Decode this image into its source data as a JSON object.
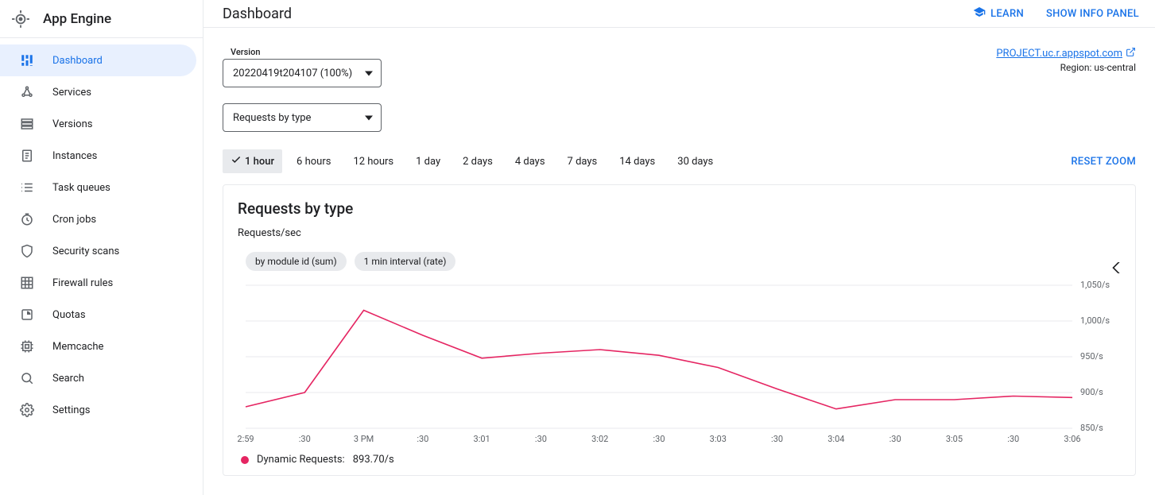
{
  "app": {
    "name": "App Engine"
  },
  "sidebar": {
    "items": [
      {
        "label": "Dashboard",
        "icon": "dashboard",
        "active": true
      },
      {
        "label": "Services",
        "icon": "graph",
        "active": false
      },
      {
        "label": "Versions",
        "icon": "versions",
        "active": false
      },
      {
        "label": "Instances",
        "icon": "clipboard",
        "active": false
      },
      {
        "label": "Task queues",
        "icon": "list",
        "active": false
      },
      {
        "label": "Cron jobs",
        "icon": "clock",
        "active": false
      },
      {
        "label": "Security scans",
        "icon": "shield",
        "active": false
      },
      {
        "label": "Firewall rules",
        "icon": "grid",
        "active": false
      },
      {
        "label": "Quotas",
        "icon": "pie",
        "active": false
      },
      {
        "label": "Memcache",
        "icon": "memory",
        "active": false
      },
      {
        "label": "Search",
        "icon": "search",
        "active": false
      },
      {
        "label": "Settings",
        "icon": "gear",
        "active": false
      }
    ]
  },
  "header": {
    "title": "Dashboard",
    "learn": "LEARN",
    "show_info": "SHOW INFO PANEL"
  },
  "project": {
    "url": "PROJECT.uc.r.appspot.com",
    "region_label": "Region: us-central"
  },
  "version": {
    "label": "Version",
    "value": "20220419t204107 (100%)"
  },
  "metric": {
    "value": "Requests by type"
  },
  "ranges": {
    "items": [
      "1 hour",
      "6 hours",
      "12 hours",
      "1 day",
      "2 days",
      "4 days",
      "7 days",
      "14 days",
      "30 days"
    ],
    "active": "1 hour",
    "reset": "RESET ZOOM"
  },
  "chart": {
    "title": "Requests by type",
    "subtitle": "Requests/sec",
    "chips": [
      "by module id (sum)",
      "1 min interval (rate)"
    ],
    "legend_label": "Dynamic Requests:",
    "legend_value": "893.70/s"
  },
  "chart_data": {
    "type": "line",
    "ylabel": "Requests/sec",
    "ylim": [
      850,
      1050
    ],
    "y_ticks": [
      "1,050/s",
      "1,000/s",
      "950/s",
      "900/s",
      "850/s"
    ],
    "x_ticks": [
      "2:59",
      ":30",
      "3 PM",
      ":30",
      "3:01",
      ":30",
      "3:02",
      ":30",
      "3:03",
      ":30",
      "3:04",
      ":30",
      "3:05",
      ":30",
      "3:06"
    ],
    "series": [
      {
        "name": "Dynamic Requests",
        "color": "#e52562",
        "x": [
          "2:59",
          ":30",
          "3 PM",
          ":30",
          "3:01",
          ":30",
          "3:02",
          ":30",
          "3:03",
          ":30",
          "3:04",
          ":30",
          "3:05",
          ":30",
          "3:06"
        ],
        "values": [
          880,
          900,
          1015,
          980,
          948,
          955,
          960,
          952,
          935,
          905,
          877,
          890,
          890,
          895,
          893
        ]
      }
    ]
  }
}
